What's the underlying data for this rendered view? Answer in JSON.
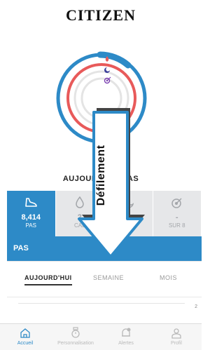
{
  "brand": {
    "logo_text": "CITIZEN"
  },
  "colors": {
    "accent": "#2d8ac7",
    "goal_ring": "#e85a5a",
    "tab_inactive": "#e6e7e9"
  },
  "rings_icons": [
    "flame-icon",
    "moon-icon",
    "target-icon"
  ],
  "today_label": "AUJOURD'HUI PAS",
  "metric_tabs": [
    {
      "id": "steps",
      "icon": "shoe-icon",
      "value": "8,414",
      "unit": "PAS",
      "active": true
    },
    {
      "id": "calories",
      "icon": "flame-icon",
      "value": "2",
      "unit": "CAL",
      "active": false
    },
    {
      "id": "sleep",
      "icon": "moon-icon",
      "value": "",
      "unit": "MIN",
      "active": false
    },
    {
      "id": "goals",
      "icon": "target-icon",
      "value": "-",
      "unit": "SUR 8",
      "active": false
    }
  ],
  "section": {
    "title": "PAS"
  },
  "periods": [
    {
      "label": "AUJOURD'HUI",
      "selected": true
    },
    {
      "label": "SEMAINE",
      "selected": false
    },
    {
      "label": "MOIS",
      "selected": false
    }
  ],
  "chart": {
    "y_tick": "2"
  },
  "overlay": {
    "label": "Défilement",
    "direction": "down"
  },
  "nav": {
    "items": [
      {
        "label": "Accueil",
        "icon": "home-icon",
        "active": true
      },
      {
        "label": "Personnalisation",
        "icon": "watch-icon",
        "active": false
      },
      {
        "label": "Alertes",
        "icon": "bell-icon",
        "active": false
      },
      {
        "label": "Profil",
        "icon": "person-icon",
        "active": false
      }
    ]
  }
}
